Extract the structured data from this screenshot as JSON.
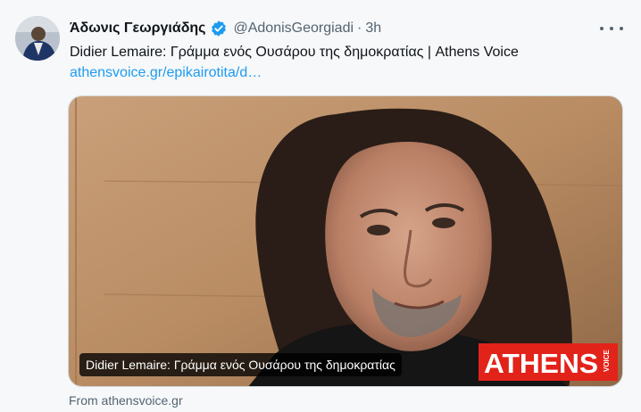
{
  "tweet": {
    "display_name": "Άδωνις Γεωργιάδης",
    "handle": "@AdonisGeorgiadi",
    "separator": "·",
    "time": "3h",
    "text": "Didier Lemaire: Γράμμα ενός Ουσάρου της δημοκρατίας | Athens Voice",
    "link": "athensvoice.gr/epikairotita/d…"
  },
  "card": {
    "caption": "Didier Lemaire: Γράμμα ενός Ουσάρου της δημοκρατίας",
    "logo_text": "ATHENS",
    "logo_subtext": "VOICE",
    "source": "From athensvoice.gr"
  },
  "icons": {
    "verified": "verified-badge-icon",
    "more": "more-options-icon"
  },
  "colors": {
    "accent": "#1d9bf0",
    "logo_red": "#e2231a",
    "secondary_text": "#536471"
  }
}
